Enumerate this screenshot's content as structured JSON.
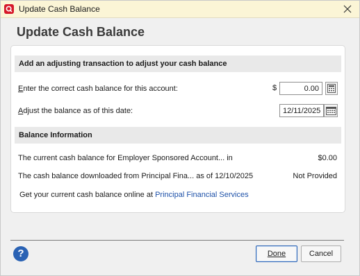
{
  "window": {
    "title": "Update Cash Balance",
    "accent_color": "#d6192a",
    "titlebar_color": "#fbf5d6"
  },
  "header": {
    "title": "Update Cash Balance"
  },
  "adjust_section": {
    "title": "Add an adjusting transaction to adjust your cash balance",
    "balance_label_prefix": "E",
    "balance_label_rest": "nter the correct cash balance for this account:",
    "currency_symbol": "$",
    "balance_value": "0.00",
    "date_label_prefix": "A",
    "date_label_rest": "djust the balance as of this date:",
    "date_value": "12/11/2025"
  },
  "info_section": {
    "title": "Balance Information",
    "rows": [
      {
        "label": "The current cash balance for Employer Sponsored Account... in",
        "value": "$0.00"
      },
      {
        "label": "The cash balance downloaded from Principal Fina... as of 12/10/2025",
        "value": "Not Provided"
      }
    ],
    "online_prefix": "Get your current cash balance online at",
    "online_link": "Principal Financial Services"
  },
  "footer": {
    "help_label": "?",
    "done_label": "Done",
    "cancel_label": "Cancel"
  },
  "icons": {
    "app": "quicken-logo-icon",
    "close": "close-icon",
    "calculator": "calculator-icon",
    "calendar": "calendar-icon",
    "help": "help-icon"
  }
}
